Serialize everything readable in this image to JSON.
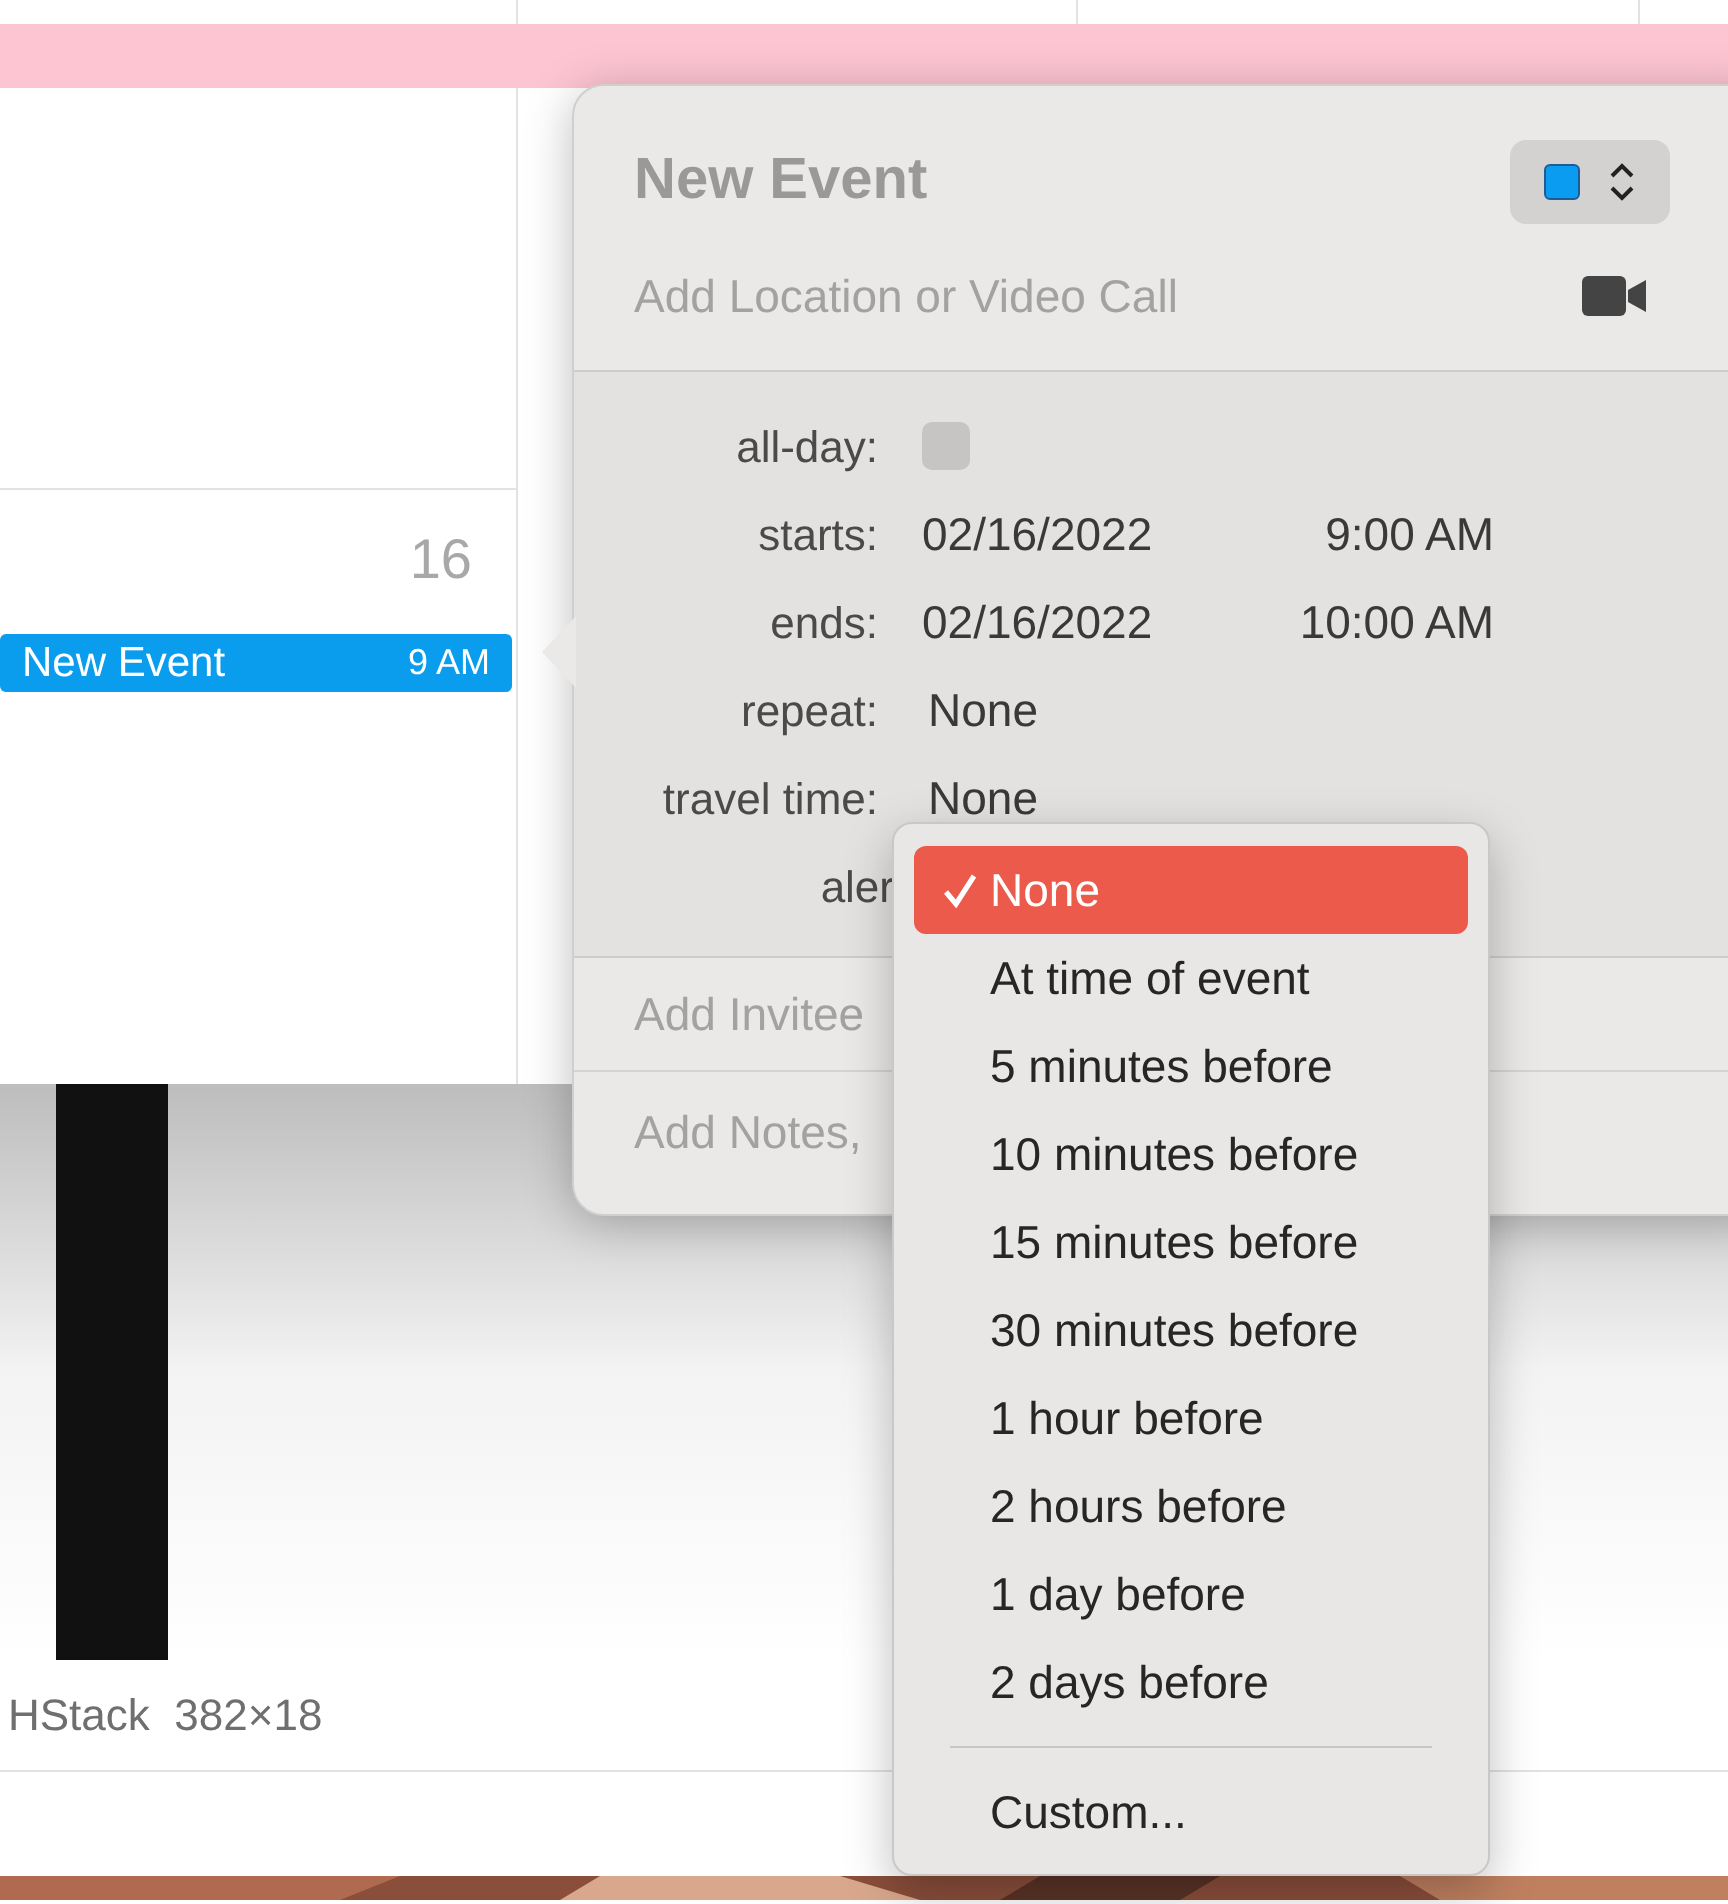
{
  "calendar": {
    "day_number": "16",
    "event": {
      "title": "New Event",
      "time": "9 AM"
    }
  },
  "inspector_label": {
    "name": "HStack",
    "size": "382×18"
  },
  "popover": {
    "title": "New Event",
    "color": "#0a9cf0",
    "location_placeholder": "Add Location or Video Call",
    "rows": [
      {
        "kind": "checkbox",
        "label": "all-day:",
        "checked": false
      },
      {
        "kind": "datetime",
        "label": "starts:",
        "date": "02/16/2022",
        "time": "9:00 AM"
      },
      {
        "kind": "datetime",
        "label": "ends:",
        "date": "02/16/2022",
        "time": "10:00 AM"
      },
      {
        "kind": "value",
        "label": "repeat:",
        "value": "None"
      },
      {
        "kind": "value",
        "label": "travel time:",
        "value": "None"
      },
      {
        "kind": "popup",
        "label": "aler"
      }
    ],
    "invitees_placeholder": "Add Invitee",
    "notes_placeholder": "Add Notes,"
  },
  "alert_menu": {
    "items": [
      {
        "label": "None",
        "selected": true
      },
      {
        "label": "At time of event",
        "selected": false
      },
      {
        "label": "5 minutes before",
        "selected": false
      },
      {
        "label": "10 minutes before",
        "selected": false
      },
      {
        "label": "15 minutes before",
        "selected": false
      },
      {
        "label": "30 minutes before",
        "selected": false
      },
      {
        "label": "1 hour before",
        "selected": false
      },
      {
        "label": "2 hours before",
        "selected": false
      },
      {
        "label": "1 day before",
        "selected": false
      },
      {
        "label": "2 days before",
        "selected": false
      }
    ],
    "footer_items": [
      "Custom..."
    ]
  }
}
